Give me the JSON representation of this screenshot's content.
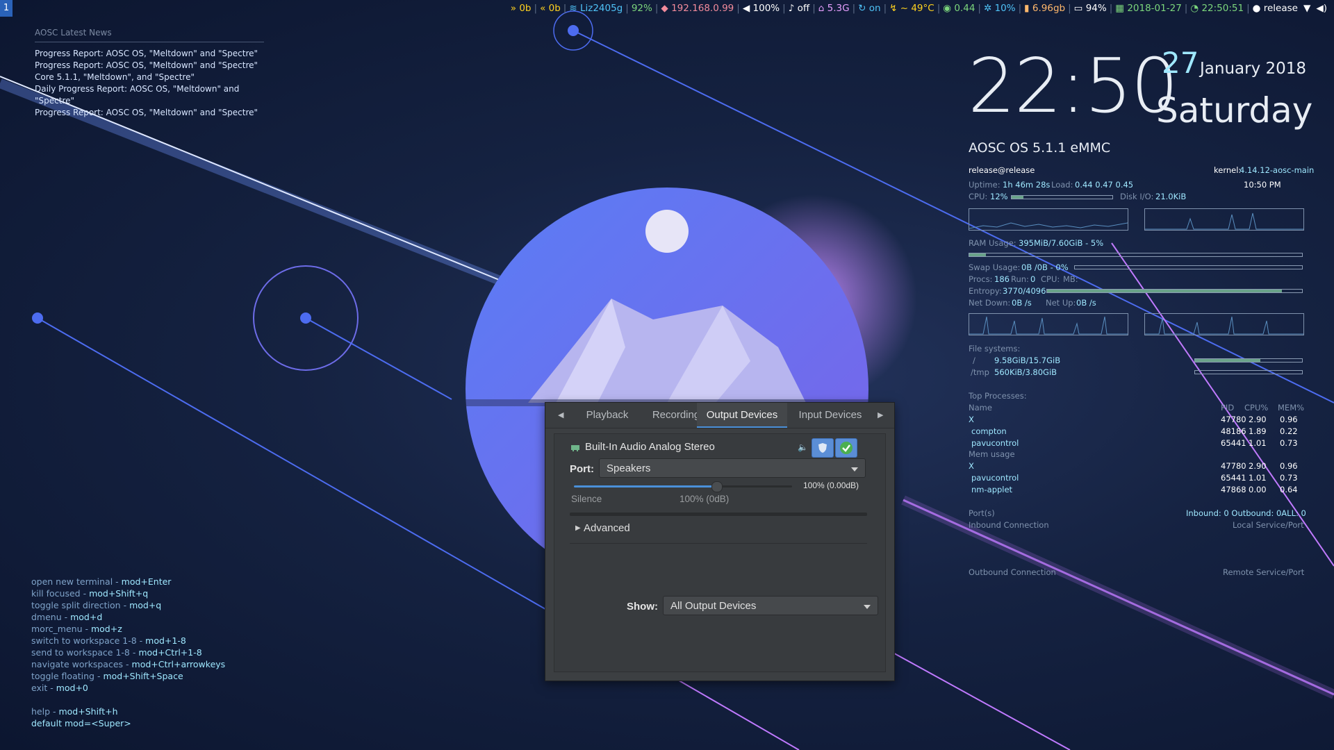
{
  "topbar": {
    "workspace": "1",
    "items": [
      {
        "icon": "download-icon",
        "text": "0b",
        "color": "#ffd21f"
      },
      {
        "icon": "upload-icon",
        "text": "0b",
        "color": "#ffd21f"
      },
      {
        "icon": "wifi-icon",
        "text": "Liz2405g",
        "color": "#4fc3f7"
      },
      {
        "icon": "signal-icon",
        "text": "92%",
        "color": "#7cd67c"
      },
      {
        "icon": "tag-icon",
        "text": "192.168.0.99",
        "color": "#f28b9b"
      },
      {
        "icon": "volume-icon",
        "text": "100%",
        "color": "#ffffff"
      },
      {
        "icon": "microphone-icon",
        "text": "off",
        "color": "#ffffff"
      },
      {
        "icon": "home-icon",
        "text": "5.3G",
        "color": "#e8a0ff"
      },
      {
        "icon": "sync-icon",
        "text": "on",
        "color": "#4fc3f7"
      },
      {
        "icon": "temperature-icon",
        "text": "~ 49°C",
        "color": "#ffd21f"
      },
      {
        "icon": "load-icon",
        "text": "0.44",
        "color": "#7cd67c"
      },
      {
        "icon": "cpu-icon",
        "text": "10%",
        "color": "#4fc3f7"
      },
      {
        "icon": "memory-icon",
        "text": "6.96gb",
        "color": "#ffb86c"
      },
      {
        "icon": "battery-icon",
        "text": "94%",
        "color": "#ffffff"
      },
      {
        "icon": "calendar-icon",
        "text": "2018-01-27",
        "color": "#7cd67c"
      },
      {
        "icon": "clock-icon",
        "text": "22:50:51",
        "color": "#7cd67c"
      },
      {
        "icon": "user-icon",
        "text": "release",
        "color": "#ffffff"
      }
    ]
  },
  "news": {
    "header": "AOSC Latest News",
    "items": [
      "Progress Report: AOSC OS, \"Meltdown\" and \"Spectre\"",
      "Progress Report: AOSC OS, \"Meltdown\" and \"Spectre\"",
      "Core 5.1.1, \"Meltdown\", and \"Spectre\"",
      "Daily Progress Report: AOSC OS, \"Meltdown\" and \"Spectre\"",
      "Progress Report: AOSC OS, \"Meltdown\" and \"Spectre\""
    ]
  },
  "keybinds": [
    {
      "label": "open new terminal - ",
      "key": "mod+Enter"
    },
    {
      "label": "kill focused - ",
      "key": "mod+Shift+q"
    },
    {
      "label": "toggle split direction - ",
      "key": "mod+q"
    },
    {
      "label": "dmenu - ",
      "key": "mod+d"
    },
    {
      "label": "morc_menu - ",
      "key": "mod+z"
    },
    {
      "label": "switch to workspace 1-8 - ",
      "key": "mod+1-8"
    },
    {
      "label": "send to workspace 1-8 - ",
      "key": "mod+Ctrl+1-8"
    },
    {
      "label": "navigate workspaces - ",
      "key": "mod+Ctrl+arrowkeys"
    },
    {
      "label": "toggle floating - ",
      "key": "mod+Shift+Space"
    },
    {
      "label": "exit - ",
      "key": "mod+0"
    },
    {
      "label": "",
      "key": ""
    },
    {
      "label": "help - ",
      "key": "mod+Shift+h"
    },
    {
      "label": "",
      "key": "default mod=<Super>"
    }
  ],
  "conky": {
    "time": "22:50",
    "day": "27",
    "month_year": "January 2018",
    "weekday": "Saturday",
    "os": "AOSC OS 5.1.1 eMMC",
    "userhost": "release@release",
    "kernel_label": "kernel:",
    "kernel": "4.14.12-aosc-main",
    "uptime_label": "Uptime:",
    "uptime": "1h 46m 28s",
    "load_label": "Load:",
    "load": "0.44 0.47 0.45",
    "time12": "10:50 PM",
    "cpu_label": "CPU:",
    "cpu": "12%",
    "cpu_level": 0.12,
    "diskio_label": "Disk I/O:",
    "diskio": "21.0KiB",
    "ram_label": "RAM Usage:",
    "ram": "395MiB/7.60GiB - 5%",
    "ram_level": 0.05,
    "swap_label": "Swap Usage:",
    "swap": "0B /0B - 0%",
    "procs_label": "Procs:",
    "procs": "186",
    "run_label": "Run:",
    "run": "0",
    "cpu2_label": "CPU:",
    "mb_label": "MB:",
    "entropy_label": "Entropy:",
    "entropy": "3770/4096",
    "entropy_level": 0.92,
    "netdown_label": "Net Down:",
    "netdown": "0B /s",
    "netup_label": "Net Up:",
    "netup": "0B /s",
    "fs_label": "File systems:",
    "fs": [
      {
        "mount": "/",
        "usage": "9.58GiB/15.7GiB",
        "level": 0.61
      },
      {
        "mount": "/tmp",
        "usage": "560KiB/3.80GiB",
        "level": 0.0
      }
    ],
    "top_label": "Top Processes:",
    "col_name": "Name",
    "col_pid": "PID",
    "col_cpu": "CPU%",
    "col_mem": "MEM%",
    "top": [
      {
        "name": "X",
        "pid": "47780",
        "cpu": "2.90",
        "mem": "0.96"
      },
      {
        "name": "compton",
        "pid": "48186",
        "cpu": "1.89",
        "mem": "0.22"
      },
      {
        "name": "pavucontrol",
        "pid": "65441",
        "cpu": "1.01",
        "mem": "0.73"
      }
    ],
    "mem_label": "Mem usage",
    "mem": [
      {
        "name": "X",
        "pid": "47780",
        "cpu": "2.90",
        "mem": "0.96"
      },
      {
        "name": "pavucontrol",
        "pid": "65441",
        "cpu": "1.01",
        "mem": "0.73"
      },
      {
        "name": "nm-applet",
        "pid": "47868",
        "cpu": "0.00",
        "mem": "0.64"
      }
    ],
    "ports_label": "Port(s)",
    "ports_value": "Inbound: 0  Outbound: 0ALL: 0",
    "inbound_conn": "Inbound Connection",
    "local_port": "Local Service/Port",
    "outbound_conn": "Outbound Connection",
    "remote_port": "Remote Service/Port"
  },
  "pavucontrol": {
    "tabs": [
      "Playback",
      "Recording",
      "Output Devices",
      "Input Devices"
    ],
    "active_tab": "Output Devices",
    "device_name": "Built-In Audio Analog Stereo",
    "port_label": "Port:",
    "port_value": "Speakers",
    "volume_level": 1.0,
    "volume_text": "100% (0.00dB)",
    "scale_silence": "Silence",
    "scale_100": "100% (0dB)",
    "advanced": "Advanced",
    "show_label": "Show:",
    "show_value": "All Output Devices",
    "accent": "#4a90d9"
  }
}
